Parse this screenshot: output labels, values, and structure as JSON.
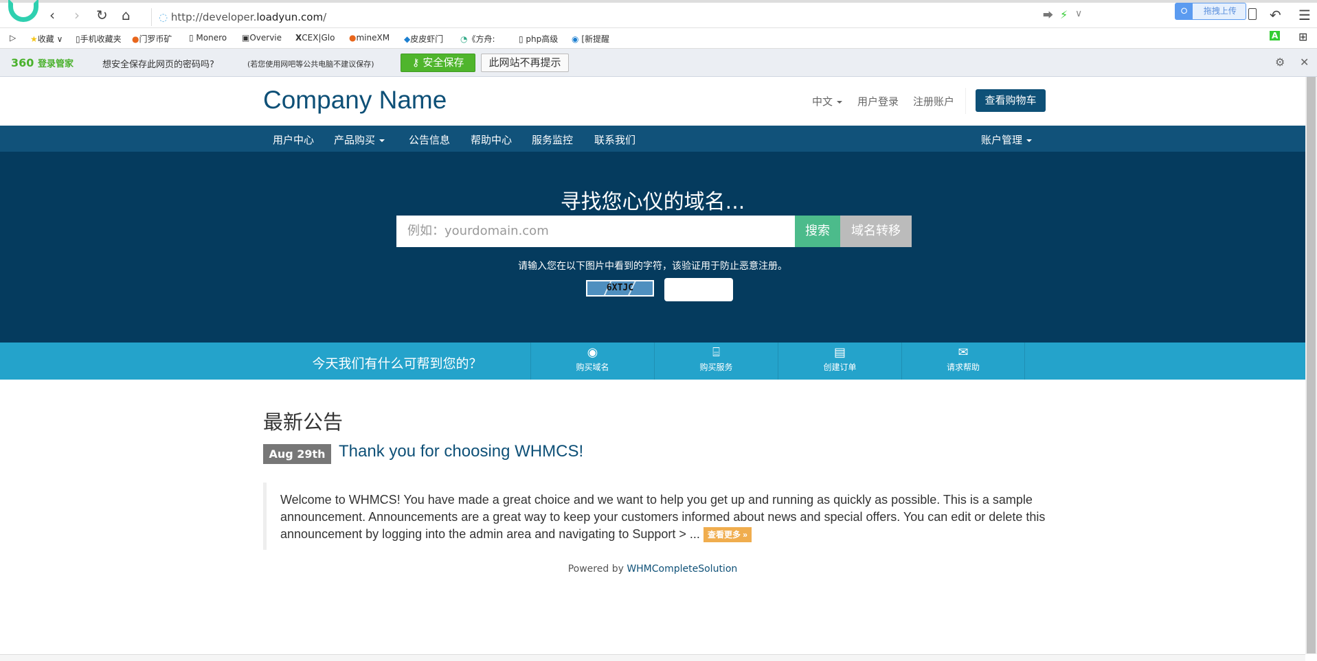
{
  "browser": {
    "url_prefix": "http://developer.",
    "url_domain": "loadyun.com",
    "url_suffix": "/",
    "upload_label": "拖拽上传",
    "bookmarks": [
      "收藏",
      "手机收藏夹",
      "门罗币矿",
      "Monero",
      "Overvie",
      "CEX|Glo",
      "mineXM",
      "皮皮虾门",
      "《方舟:",
      "php高级",
      "[新提醒"
    ]
  },
  "password_bar": {
    "brand": "360",
    "brand_sub": "登录管家",
    "question": "想安全保存此网页的密码吗?",
    "note": "(若您使用网吧等公共电脑不建议保存)",
    "save_label": "安全保存",
    "never_label": "此网站不再提示"
  },
  "header": {
    "logo": "Company Name",
    "language": "中文",
    "login": "用户登录",
    "register": "注册账户",
    "cart": "查看购物车"
  },
  "nav": {
    "items": [
      "用户中心",
      "产品购买",
      "公告信息",
      "帮助中心",
      "服务监控",
      "联系我们"
    ],
    "account": "账户管理"
  },
  "hero": {
    "title": "寻找您心仪的域名...",
    "placeholder": "例如：yourdomain.com",
    "search": "搜索",
    "transfer": "域名转移",
    "captcha_prompt": "请输入您在以下图片中看到的字符，该验证用于防止恶意注册。",
    "captcha_code": "6XTJC"
  },
  "help": {
    "question": "今天我们有什么可帮到您的？",
    "items": [
      "购买域名",
      "购买服务",
      "创建订单",
      "请求帮助"
    ]
  },
  "announcements": {
    "heading": "最新公告",
    "date": "Aug 29th",
    "title": "Thank you for choosing WHMCS!",
    "body": "Welcome to WHMCS! You have made a great choice and we want to help you get up and running as quickly as possible. This is a sample announcement. Announcements are a great way to keep your customers informed about news and special offers. You can edit or delete this announcement by logging into the admin area and navigating to Support > ...",
    "more": "查看更多 »"
  },
  "footer": {
    "powered_prefix": "Powered by ",
    "powered_link": "WHMCompleteSolution"
  }
}
